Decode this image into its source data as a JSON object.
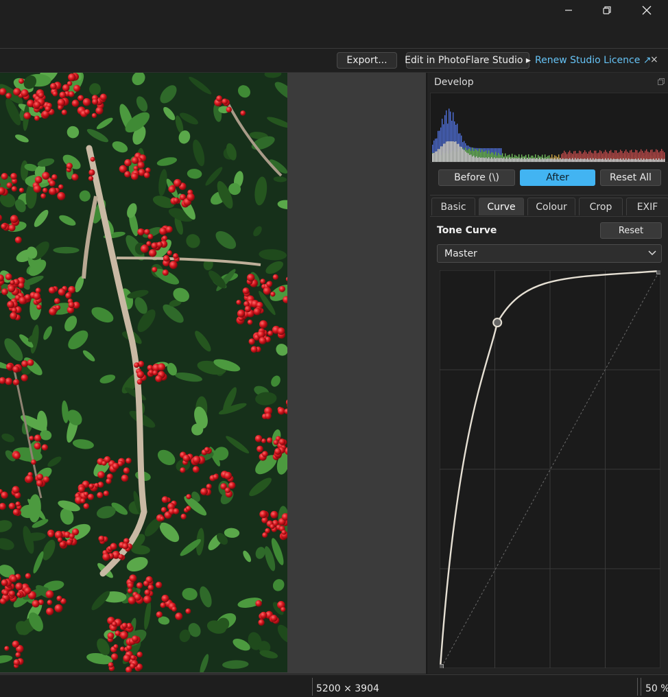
{
  "window": {
    "controls": {
      "minimize": "minimize",
      "maximize": "maximize",
      "close": "close"
    }
  },
  "toolbar": {
    "export_label": "Export...",
    "edit_label": "Edit in PhotoFlare Studio ▸",
    "renew_label": "Renew Studio Licence ↗",
    "dismiss_label": "×"
  },
  "panel": {
    "title": "Develop",
    "before_label": "Before  (\\)",
    "after_label": "After",
    "reset_all_label": "Reset All",
    "tabs": [
      {
        "label": "Basic",
        "selected": false
      },
      {
        "label": "Curve",
        "selected": true
      },
      {
        "label": "Colour",
        "selected": false
      },
      {
        "label": "Crop",
        "selected": false
      },
      {
        "label": "EXIF",
        "selected": false
      }
    ],
    "tone_curve": {
      "title": "Tone Curve",
      "reset_label": "Reset",
      "channel": "Master",
      "points": [
        {
          "input": 0,
          "output": 0
        },
        {
          "input": 0.26,
          "output": 0.87
        },
        {
          "input": 1,
          "output": 1
        }
      ]
    }
  },
  "status": {
    "dimensions": "5200 × 3904",
    "zoom": "50 %"
  },
  "colors": {
    "accent": "#42b4f2",
    "link": "#66c3f5",
    "panel_bg": "#232323",
    "canvas_bg": "#3b3b3b"
  }
}
